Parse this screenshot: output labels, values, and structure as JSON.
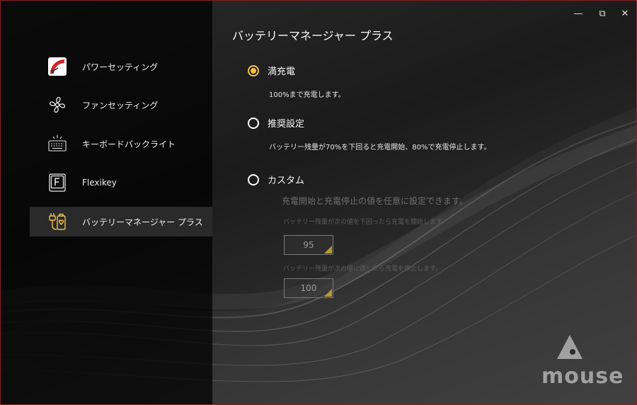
{
  "window": {
    "controls": {
      "minimize": "—",
      "restore": "⧉",
      "close": "✕"
    }
  },
  "sidebar": {
    "items": [
      {
        "label": "パワーセッティング",
        "icon": "power-gauge-icon",
        "active": false
      },
      {
        "label": "ファンセッティング",
        "icon": "fan-icon",
        "active": false
      },
      {
        "label": "キーボードバックライト",
        "icon": "keyboard-backlight-icon",
        "active": false
      },
      {
        "label": "Flexikey",
        "icon": "flexikey-icon",
        "active": false
      },
      {
        "label": "バッテリーマネージャー プラス",
        "icon": "battery-manager-icon",
        "active": true
      }
    ]
  },
  "main": {
    "title": "バッテリーマネージャー プラス",
    "options": [
      {
        "label": "満充電",
        "desc": "100%まで充電します。",
        "checked": true
      },
      {
        "label": "推奨設定",
        "desc": "バッテリー残量が70%を下回ると充電開始、80%で充電停止します。",
        "checked": false
      },
      {
        "label": "カスタム",
        "checked": false
      }
    ],
    "custom": {
      "heading": "充電開始と充電停止の値を任意に設定できます。",
      "start_label": "バッテリー残量が次の値を下回ったら充電を開始します。",
      "start_value": "95",
      "stop_label": "バッテリー残量が次の値に達したら充電を停止します。",
      "stop_value": "100"
    }
  },
  "brand": {
    "logo_text": "mouse"
  },
  "colors": {
    "accent": "#f2c14a",
    "border": "#8a2020",
    "logo": "#a0a0a0"
  }
}
